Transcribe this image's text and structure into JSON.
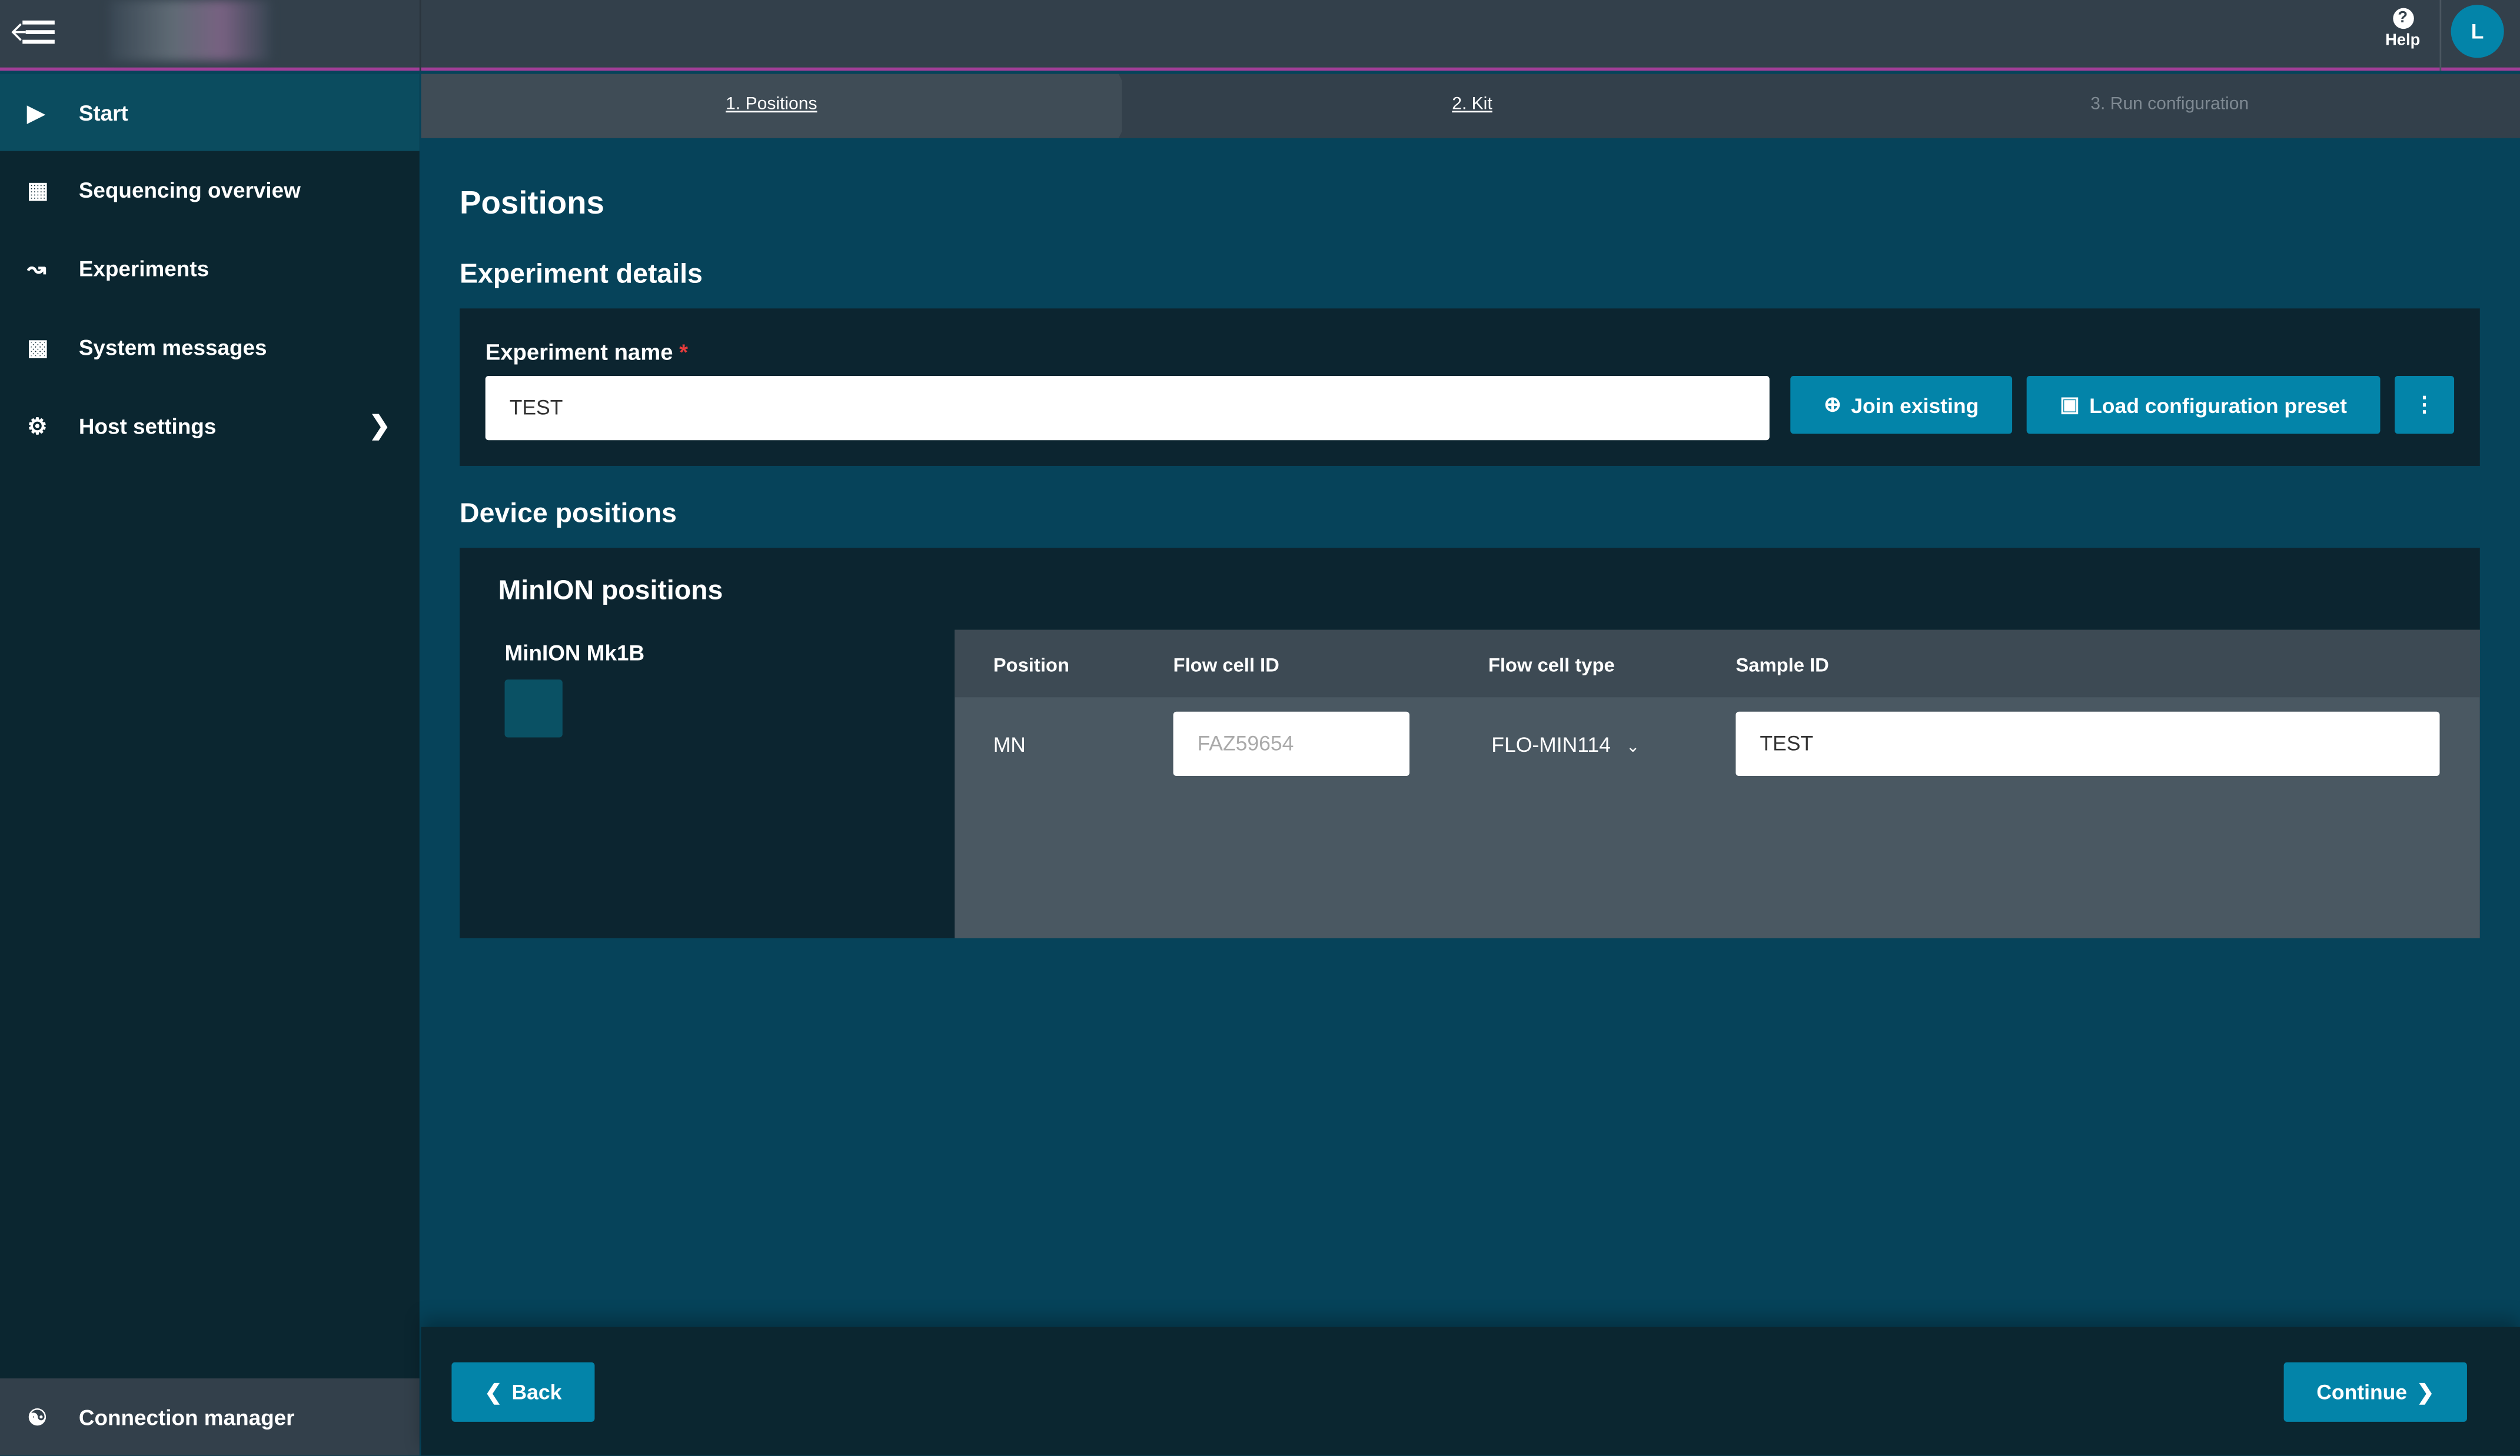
{
  "header": {
    "help_label": "Help",
    "user_initial": "L"
  },
  "sidebar": {
    "items": [
      {
        "label": "Start",
        "icon": "play-circle-icon"
      },
      {
        "label": "Sequencing overview",
        "icon": "grid-icon"
      },
      {
        "label": "Experiments",
        "icon": "line-chart-icon"
      },
      {
        "label": "System messages",
        "icon": "message-icon"
      },
      {
        "label": "Host settings",
        "icon": "gear-icon"
      }
    ],
    "connection_manager": "Connection manager"
  },
  "steps": [
    {
      "label": "1. Positions"
    },
    {
      "label": "2. Kit"
    },
    {
      "label": "3. Run configuration"
    }
  ],
  "page": {
    "title": "Positions",
    "experiment_details": "Experiment details",
    "experiment_name_label": "Experiment name",
    "required_mark": "*",
    "experiment_name_value": "TEST",
    "join_existing": "Join existing",
    "load_preset": "Load configuration preset",
    "device_positions": "Device positions"
  },
  "minion": {
    "title": "MinION positions",
    "device": "MinION Mk1B",
    "columns": [
      "Position",
      "Flow cell ID",
      "Flow cell type",
      "Sample ID"
    ],
    "row": {
      "position": "MN",
      "flow_cell_id_placeholder": "FAZ59654",
      "flow_cell_type": "FLO-MIN114",
      "sample_id": "TEST"
    }
  },
  "footer": {
    "back": "Back",
    "continue": "Continue"
  },
  "colors": {
    "accent": "#0384a9",
    "header_border": "#a23e98",
    "required": "#e53c3c"
  }
}
